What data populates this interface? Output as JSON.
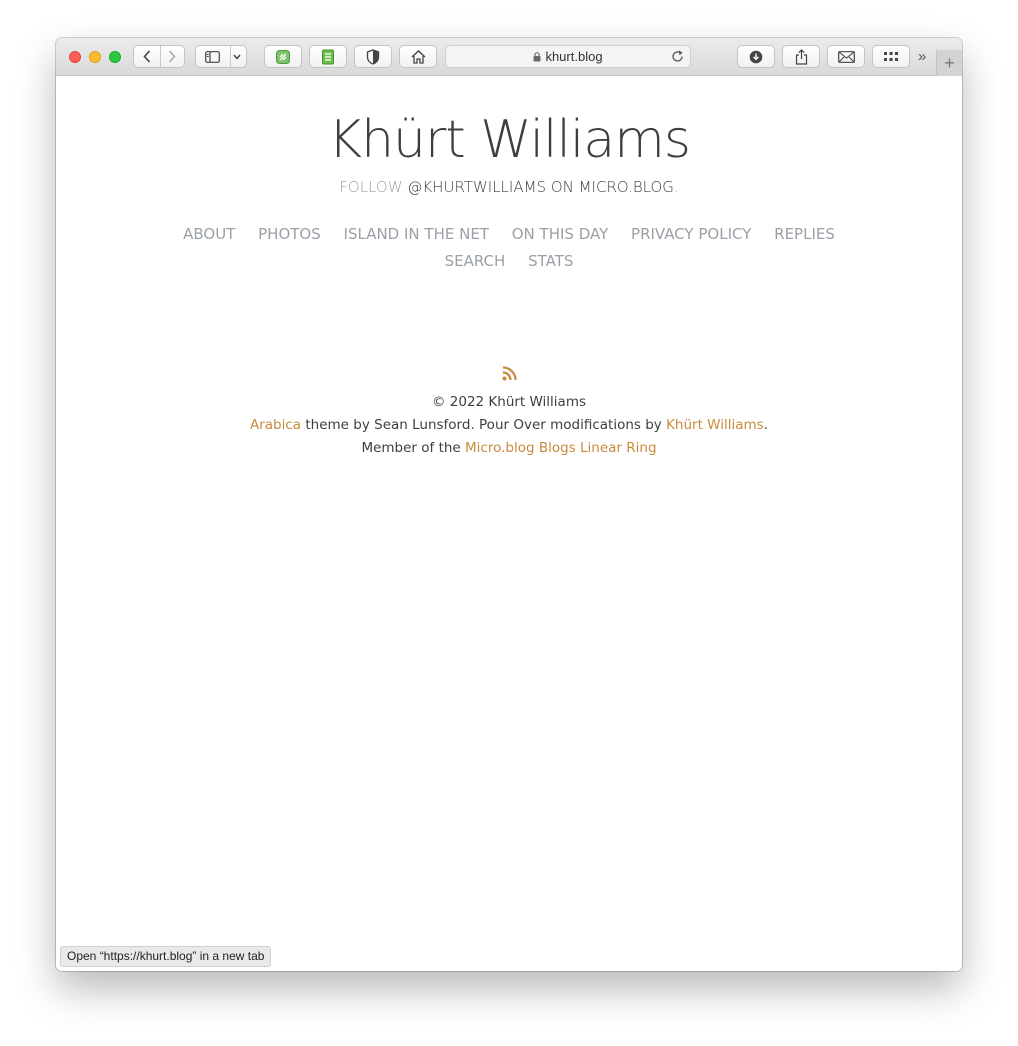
{
  "browser": {
    "address": "khurt.blog",
    "status_bar": "Open “https://khurt.blog” in a new tab",
    "new_tab_label": "+",
    "overflow_label": "»"
  },
  "site": {
    "title": "Khürt Williams",
    "follow_prefix": "FOLLOW",
    "follow_handle": "@KHURTWILLIAMS ON MICRO.BLOG",
    "follow_suffix": ".",
    "nav": [
      "ABOUT",
      "PHOTOS",
      "ISLAND IN THE NET",
      "ON THIS DAY",
      "PRIVACY POLICY",
      "REPLIES",
      "SEARCH",
      "STATS"
    ]
  },
  "footer": {
    "copyright": "© 2022 Khürt Williams",
    "theme_link": "Arabica",
    "theme_text": " theme by Sean Lunsford. Pour Over modifications by ",
    "author_link": "Khürt Williams",
    "theme_end": ".",
    "member_text": "Member of the ",
    "ring_link": "Micro.blog Blogs Linear Ring"
  },
  "colors": {
    "accent": "#c98a3e",
    "nav": "#9aa0a6",
    "text": "#3a3f44"
  }
}
